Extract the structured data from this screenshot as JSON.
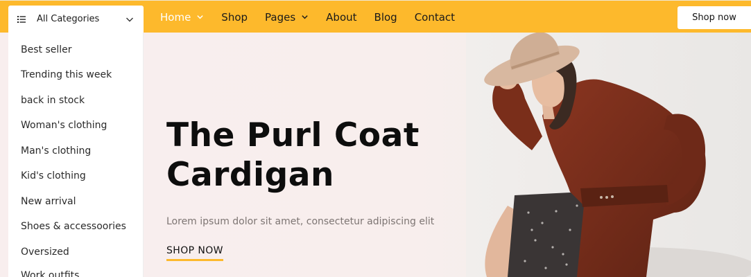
{
  "categories": {
    "header_label": "All Categories",
    "items": [
      "Best seller",
      "Trending this week",
      "back in stock",
      "Woman's clothing",
      "Man's clothing",
      "Kid's clothing",
      "New arrival",
      "Shoes & accessoories",
      "Oversized",
      "Work outfits"
    ]
  },
  "nav": {
    "items": [
      {
        "label": "Home",
        "has_dropdown": true,
        "active": true
      },
      {
        "label": "Shop",
        "has_dropdown": false,
        "active": false
      },
      {
        "label": "Pages",
        "has_dropdown": true,
        "active": false
      },
      {
        "label": "About",
        "has_dropdown": false,
        "active": false
      },
      {
        "label": "Blog",
        "has_dropdown": false,
        "active": false
      },
      {
        "label": "Contact",
        "has_dropdown": false,
        "active": false
      }
    ],
    "shop_now_label": "Shop now"
  },
  "hero": {
    "title_line1": "The Purl Coat",
    "title_line2": "Cardigan",
    "subtitle": "Lorem ipsum dolor sit amet, consectetur adipiscing elit",
    "cta_label": "SHOP NOW"
  },
  "colors": {
    "accent": "#fdb92c",
    "hero_bg": "#f8eeee",
    "coat": "#7a2e1a",
    "hat": "#d8b8a0"
  },
  "icons": {
    "categories": "list-icon",
    "dropdown": "chevron-down-icon"
  }
}
